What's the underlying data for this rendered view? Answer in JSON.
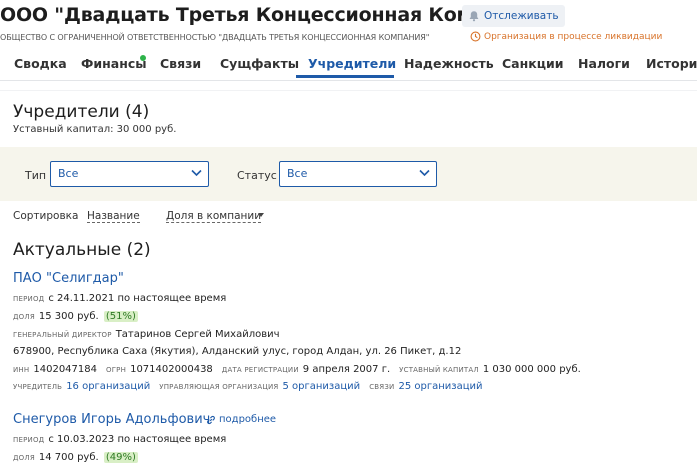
{
  "header": {
    "title": "ООО \"Двадцать Третья Концессионная Компания\"",
    "follow_label": "Отслеживать",
    "full_name": "ОБЩЕСТВО С ОГРАНИЧЕННОЙ ОТВЕТСТВЕННОСТЬЮ \"ДВАДЦАТЬ ТРЕТЬЯ КОНЦЕССИОННАЯ КОМПАНИЯ\"",
    "status": "Организация в процессе ликвидации"
  },
  "tabs": [
    {
      "label": "Сводка"
    },
    {
      "label": "Финансы"
    },
    {
      "label": "Связи"
    },
    {
      "label": "Сущфакты"
    },
    {
      "label": "Учредители"
    },
    {
      "label": "Надежность"
    },
    {
      "label": "Санкции"
    },
    {
      "label": "Налоги"
    },
    {
      "label": "История"
    }
  ],
  "founders": {
    "title": "Учредители (4)",
    "capital": "Уставный капитал: 30 000 руб."
  },
  "filters": {
    "type_label": "Тип",
    "type_value": "Все",
    "status_label": "Статус",
    "status_value": "Все"
  },
  "sort": {
    "label": "Сортировка",
    "by_name": "Название",
    "by_share": "Доля в компании"
  },
  "actual_title": "Актуальные (2)",
  "entries": [
    {
      "name": "ПАО \"Селигдар\"",
      "period_cap": "период",
      "period": "с 24.11.2021 по настоящее время",
      "share_cap": "доля",
      "share": "15 300 руб.",
      "share_pct": "(51%)",
      "director_cap": "генеральный директор",
      "director": "Татаринов Сергей Михайлович",
      "address": "678900, Республика Саха (Якутия), Алданский улус, город Алдан, ул. 26 Пикет, д.12",
      "inn_cap": "инн",
      "inn": "1402047184",
      "ogrn_cap": "огрн",
      "ogrn": "1071402000438",
      "reg_cap": "дата регистрации",
      "reg": "9 апреля 2007 г.",
      "capital_cap": "уставный капитал",
      "capital": "1 030 000 000 руб.",
      "founder_cap": "учредитель",
      "founder": "16 организаций",
      "managing_cap": "управляющая организация",
      "managing": "5 организаций",
      "links_cap": "связи",
      "links": "25 организаций"
    },
    {
      "name": "Снегуров Игорь Адольфович",
      "more": "подробнее",
      "period_cap": "период",
      "period": "с 10.03.2023 по настоящее время",
      "share_cap": "доля",
      "share": "14 700 руб.",
      "share_pct": "(49%)"
    }
  ]
}
